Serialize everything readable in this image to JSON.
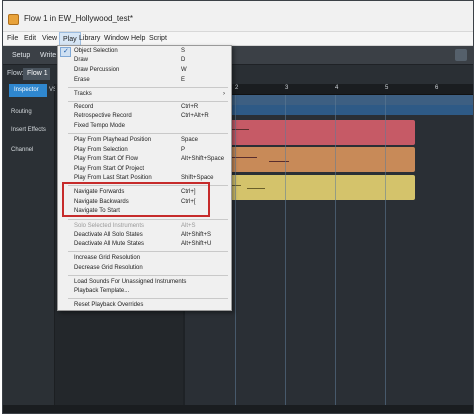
{
  "window": {
    "title": "Flow 1 in EW_Hollywood_test*"
  },
  "menubar": {
    "items": [
      "File",
      "Edit",
      "View",
      "Play",
      "Library",
      "Window",
      "Help",
      "Script"
    ]
  },
  "toolbar": {
    "setup_label": "Setup",
    "write_label": "Write"
  },
  "flowbar": {
    "label": "Flow:",
    "tab": "Flow 1"
  },
  "left_panel": {
    "inspector_tab": "Inspector",
    "vst_tab": "VS",
    "sections": [
      "Routing",
      "Insert Effects",
      "Channel"
    ]
  },
  "ruler": {
    "numbers": [
      "2",
      "3",
      "4",
      "5",
      "6"
    ]
  },
  "play_menu": {
    "object_selection": {
      "label": "Object Selection",
      "shortcut": "S"
    },
    "draw": {
      "label": "Draw",
      "shortcut": "D"
    },
    "draw_percussion": {
      "label": "Draw Percussion",
      "shortcut": "W"
    },
    "erase": {
      "label": "Erase",
      "shortcut": "E"
    },
    "tracks": {
      "label": "Tracks",
      "shortcut": ""
    },
    "record": {
      "label": "Record",
      "shortcut": "Ctrl+R"
    },
    "retrospective_record": {
      "label": "Retrospective Record",
      "shortcut": "Ctrl+Alt+R"
    },
    "fixed_tempo_mode": {
      "label": "Fixed Tempo Mode",
      "shortcut": ""
    },
    "play_from_playhead": {
      "label": "Play From Playhead Position",
      "shortcut": "Space"
    },
    "play_from_selection": {
      "label": "Play From Selection",
      "shortcut": "P"
    },
    "play_from_start_of_flow": {
      "label": "Play From Start Of Flow",
      "shortcut": "Alt+Shift+Space"
    },
    "play_from_start_of_project": {
      "label": "Play From Start Of Project",
      "shortcut": ""
    },
    "play_from_last_start": {
      "label": "Play From Last Start Position",
      "shortcut": "Shift+Space"
    },
    "navigate_forwards": {
      "label": "Navigate Forwards",
      "shortcut": "Ctrl+]"
    },
    "navigate_backwards": {
      "label": "Navigate Backwards",
      "shortcut": "Ctrl+["
    },
    "navigate_to_start": {
      "label": "Navigate To Start",
      "shortcut": ""
    },
    "solo_selected": {
      "label": "Solo Selected Instruments",
      "shortcut": "Alt+S"
    },
    "deactivate_solo": {
      "label": "Deactivate All Solo States",
      "shortcut": "Alt+Shift+S"
    },
    "deactivate_mute": {
      "label": "Deactivate All Mute States",
      "shortcut": "Alt+Shift+U"
    },
    "increase_grid": {
      "label": "Increase Grid Resolution",
      "shortcut": ""
    },
    "decrease_grid": {
      "label": "Decrease Grid Resolution",
      "shortcut": ""
    },
    "load_sounds": {
      "label": "Load Sounds For Unassigned Instruments",
      "shortcut": ""
    },
    "playback_template": {
      "label": "Playback Template...",
      "shortcut": ""
    },
    "reset_overrides": {
      "label": "Reset Playback Overrides",
      "shortcut": ""
    }
  },
  "colors": {
    "accent": "#2f87cf",
    "highlight_border": "#c62b2b",
    "region_red": "#c65a66",
    "region_orange": "#c88a58",
    "region_yellow": "#d4c36b"
  }
}
